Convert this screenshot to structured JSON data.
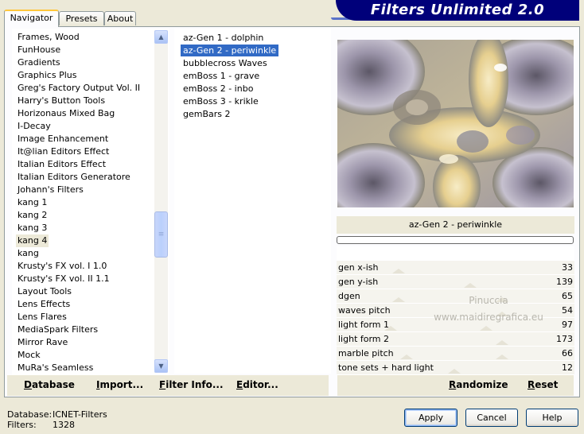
{
  "app": {
    "title": "Filters Unlimited 2.0"
  },
  "tabs": [
    {
      "label": "Navigator",
      "active": true
    },
    {
      "label": "Presets",
      "active": false
    },
    {
      "label": "About",
      "active": false
    }
  ],
  "categories": {
    "items": [
      "Frames, Wood",
      "FunHouse",
      "Gradients",
      "Graphics Plus",
      "Greg's Factory Output Vol. II",
      "Harry's Button Tools",
      "Horizonaus Mixed Bag",
      "I-Decay",
      "Image Enhancement",
      "It@lian Editors Effect",
      "Italian Editors Effect",
      "Italian Editors Generatore",
      "Johann's Filters",
      "kang 1",
      "kang 2",
      "kang 3",
      "kang 4",
      "kang",
      "Krusty's FX vol. I 1.0",
      "Krusty's FX vol. II 1.1",
      "Layout Tools",
      "Lens Effects",
      "Lens Flares",
      "MediaSpark Filters",
      "Mirror Rave",
      "Mock",
      "MuRa's Seamless"
    ],
    "selected": "kang 4"
  },
  "filters": {
    "items": [
      "az-Gen 1  -  dolphin",
      "az-Gen 2  -  periwinkle",
      "bubblecross Waves",
      "emBoss 1  -  grave",
      "emBoss 2  -  inbo",
      "emBoss 3  -  krikle",
      "gemBars 2"
    ],
    "selected": "az-Gen 2  -  periwinkle"
  },
  "preview": {
    "label": "az-Gen 2  -  periwinkle"
  },
  "params": [
    {
      "name": "gen x-ish",
      "value": "33",
      "level": 33
    },
    {
      "name": "gen y-ish",
      "value": "139",
      "level": 139
    },
    {
      "name": "dgen",
      "value": "65",
      "level": 65
    },
    {
      "name": "waves pitch",
      "value": "54",
      "level": 54
    },
    {
      "name": "light form 1",
      "value": "97",
      "level": 97
    },
    {
      "name": "light form 2",
      "value": "173",
      "level": 173
    },
    {
      "name": "marble pitch",
      "value": "66",
      "level": 66
    },
    {
      "name": "tone sets + hard light",
      "value": "12",
      "level": 12
    }
  ],
  "watermark": {
    "line1": "Pinuccia",
    "line2": "www.maidiregrafica.eu"
  },
  "toolbar": {
    "database": "Database",
    "import": "Import...",
    "filter_info": "Filter Info...",
    "editor": "Editor..."
  },
  "toolbar2": {
    "randomize": "Randomize",
    "reset": "Reset"
  },
  "status": {
    "database_label": "Database:",
    "database_value": "ICNET-Filters",
    "filters_label": "Filters:",
    "filters_value": "1328"
  },
  "buttons": {
    "apply": "Apply",
    "cancel": "Cancel",
    "help": "Help"
  },
  "colors": {
    "banner": "#00007a",
    "selection": "#316ac5",
    "tab_highlight": "#ffc73c"
  }
}
